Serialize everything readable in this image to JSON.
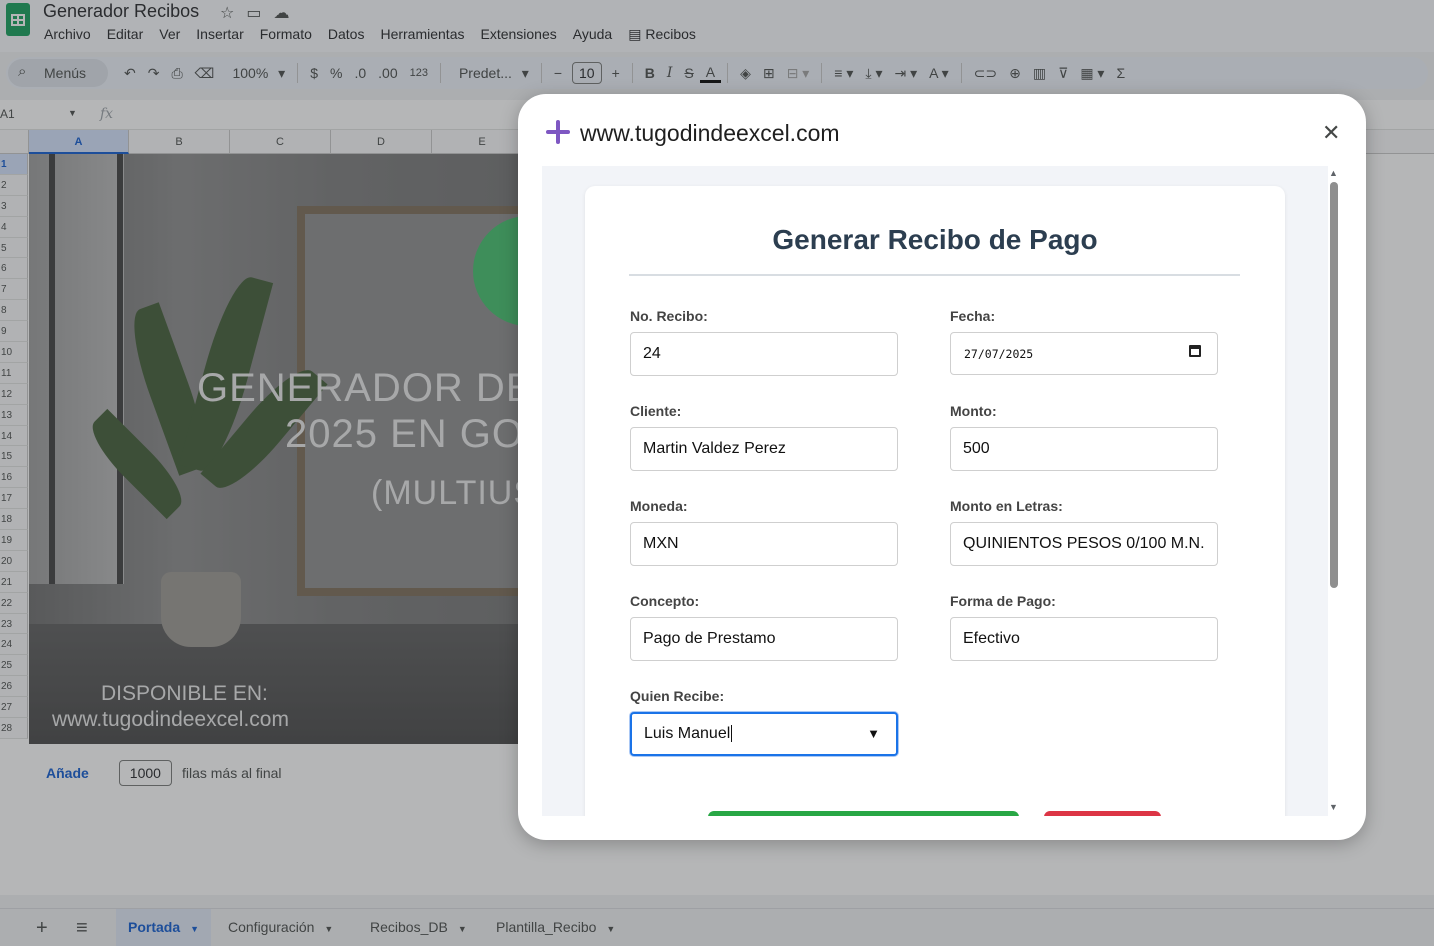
{
  "app": {
    "doc_title": "Generador Recibos",
    "menus": [
      "Archivo",
      "Editar",
      "Ver",
      "Insertar",
      "Formato",
      "Datos",
      "Herramientas",
      "Extensiones",
      "Ayuda",
      "Recibos"
    ]
  },
  "toolbar": {
    "search_label": "Menús",
    "zoom": "100%",
    "currency": "$",
    "percent": "%",
    "dec_decrease": ".0",
    "dec_increase": ".00",
    "number_format": "123",
    "font_name": "Predet...",
    "font_size": "10"
  },
  "formula_bar": {
    "name_box": "A1",
    "fx": "fx"
  },
  "grid": {
    "columns": [
      "A",
      "B",
      "C",
      "D",
      "E"
    ],
    "rows": [
      "1",
      "2",
      "3",
      "4",
      "5",
      "6",
      "7",
      "8",
      "9",
      "10",
      "11",
      "12",
      "13",
      "14",
      "15",
      "16",
      "17",
      "18",
      "19",
      "20",
      "21",
      "22",
      "23",
      "24",
      "25",
      "26",
      "27",
      "28"
    ]
  },
  "cover": {
    "line1": "GENERADOR DE",
    "line2": "2025 EN GO",
    "line3": "(MULTIUS",
    "line4": "DISPONIBLE EN:",
    "line5": "www.tugodindeexcel.com"
  },
  "add_rows": {
    "button": "Añade",
    "count": "1000",
    "suffix": "filas más al final"
  },
  "sheet_tabs": [
    {
      "label": "Portada"
    },
    {
      "label": "Configuración"
    },
    {
      "label": "Recibos_DB"
    },
    {
      "label": "Plantilla_Recibo"
    }
  ],
  "dialog": {
    "title": "www.tugodindeexcel.com",
    "form_title": "Generar Recibo de Pago",
    "fields": {
      "no_recibo": {
        "label": "No. Recibo:",
        "value": "24"
      },
      "fecha": {
        "label": "Fecha:",
        "value": "27/07/2025"
      },
      "cliente": {
        "label": "Cliente:",
        "value": "Martin Valdez Perez"
      },
      "monto": {
        "label": "Monto:",
        "value": "500"
      },
      "moneda": {
        "label": "Moneda:",
        "value": "MXN"
      },
      "monto_letras": {
        "label": "Monto en Letras:",
        "value": "QUINIENTOS PESOS 0/100 M.N."
      },
      "concepto": {
        "label": "Concepto:",
        "value": "Pago de Prestamo"
      },
      "forma_pago": {
        "label": "Forma de Pago:",
        "value": "Efectivo"
      },
      "quien_recibe": {
        "label": "Quien Recibe:",
        "value": "Luis Manuel"
      }
    }
  },
  "colors": {
    "accent_purple": "#7e57c2",
    "save_green": "#28a745",
    "cancel_red": "#dc3545",
    "focus_blue": "#1a73e8"
  }
}
